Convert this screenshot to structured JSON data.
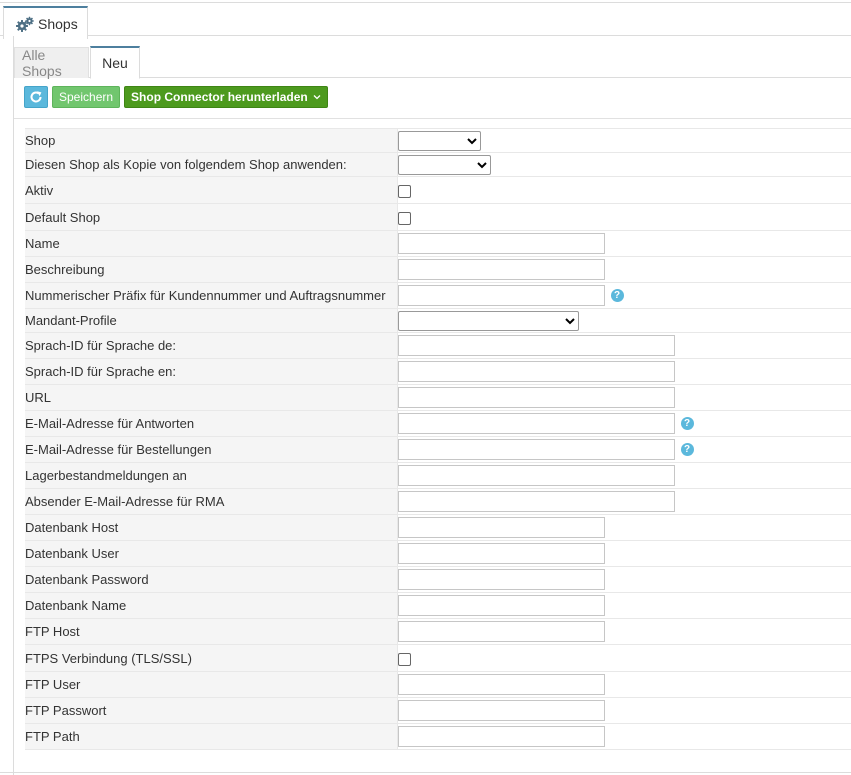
{
  "outer_tab": {
    "label": "Shops",
    "icon": "gears-icon"
  },
  "inner_tabs": [
    {
      "label": "Alle Shops",
      "active": false
    },
    {
      "label": "Neu",
      "active": true
    }
  ],
  "toolbar": {
    "refresh_icon": "refresh-icon",
    "save_label": "Speichern",
    "connector_label": "Shop Connector herunterladen"
  },
  "colors": {
    "accent": "#4d7f9e",
    "refresh_button": "#5bb8dc",
    "save_button": "#71c66e",
    "connector_button": "#4d9a1e",
    "help_icon": "#5bb8dc"
  },
  "form": {
    "shop": "Shop",
    "copy_from": "Diesen Shop als Kopie von folgendem Shop anwenden:",
    "active": "Aktiv",
    "default_shop": "Default Shop",
    "name": "Name",
    "description": "Beschreibung",
    "numeric_prefix": "Nummerischer Präfix für Kundennummer und Auftragsnummer",
    "client_profile": "Mandant-Profile",
    "lang_id_de": "Sprach-ID für Sprache de:",
    "lang_id_en": "Sprach-ID für Sprache en:",
    "url": "URL",
    "email_replies": "E-Mail-Adresse für Antworten",
    "email_orders": "E-Mail-Adresse für Bestellungen",
    "stock_reports": "Lagerbestandmeldungen an",
    "rma_sender": "Absender E-Mail-Adresse für RMA",
    "db_host": "Datenbank Host",
    "db_user": "Datenbank User",
    "db_password": "Datenbank Password",
    "db_name": "Datenbank Name",
    "ftp_host": "FTP Host",
    "ftps": "FTPS Verbindung (TLS/SSL)",
    "ftp_user": "FTP User",
    "ftp_password": "FTP Passwort",
    "ftp_path": "FTP Path"
  }
}
